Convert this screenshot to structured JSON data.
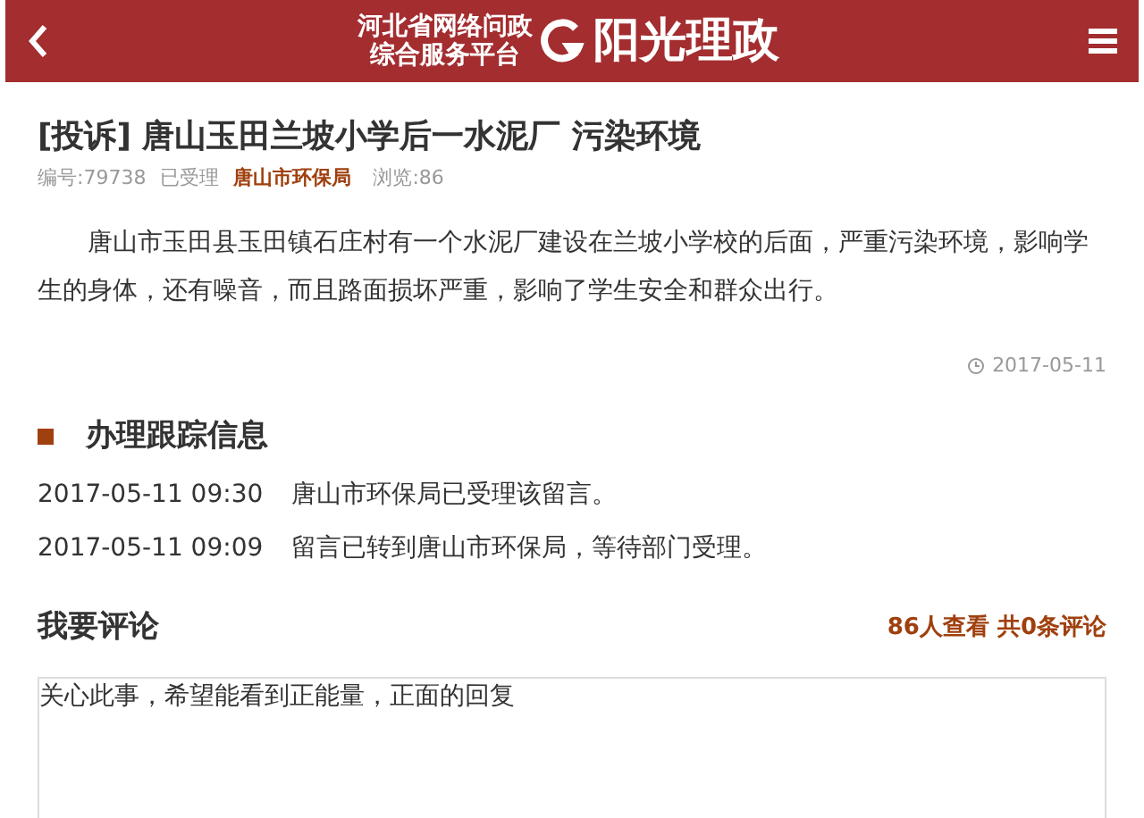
{
  "header": {
    "logo_line_1": "河北省网络问政",
    "logo_line_2": "综合服务平台",
    "logo_brand": "阳光理政"
  },
  "post": {
    "title": "[投诉] 唐山玉田兰坡小学后一水泥厂 污染环境",
    "number": "编号:79738",
    "status": "已受理",
    "department": "唐山市环保局",
    "views": "浏览:86",
    "body": "唐山市玉田县玉田镇石庄村有一个水泥厂建设在兰坡小学校的后面，严重污染环境，影响学生的身体，还有噪音，而且路面损坏严重，影响了学生安全和群众出行。",
    "date": "2017-05-11"
  },
  "tracking": {
    "title": "办理跟踪信息",
    "entries": [
      {
        "time": "2017-05-11 09:30",
        "text": "唐山市环保局已受理该留言。"
      },
      {
        "time": "2017-05-11 09:09",
        "text": "留言已转到唐山市环保局，等待部门受理。"
      }
    ]
  },
  "comments": {
    "title": "我要评论",
    "stats": "86人查看 共0条评论",
    "input_value": "关心此事，希望能看到正能量，正面的回复"
  }
}
